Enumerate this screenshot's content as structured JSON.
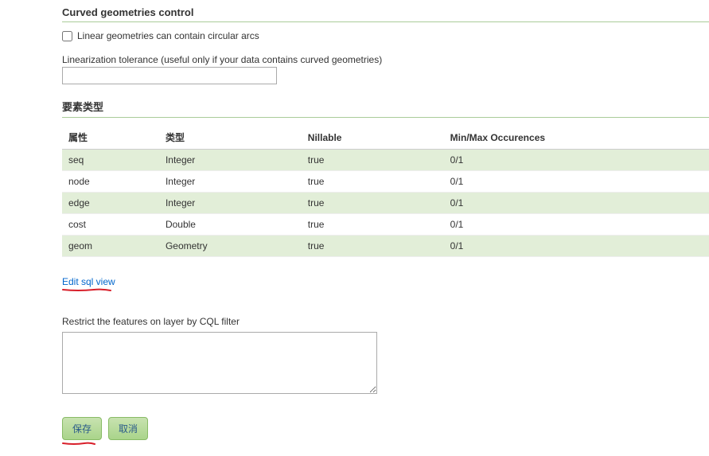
{
  "curvedGeometries": {
    "title": "Curved geometries control",
    "checkboxLabel": "Linear geometries can contain circular arcs",
    "linearizationLabel": "Linearization tolerance (useful only if your data contains curved geometries)",
    "linearizationValue": ""
  },
  "featureType": {
    "title": "要素类型",
    "headers": {
      "attribute": "属性",
      "type": "类型",
      "nillable": "Nillable",
      "minmax": "Min/Max Occurences"
    },
    "rows": [
      {
        "attr": "seq",
        "type": "Integer",
        "nillable": "true",
        "minmax": "0/1"
      },
      {
        "attr": "node",
        "type": "Integer",
        "nillable": "true",
        "minmax": "0/1"
      },
      {
        "attr": "edge",
        "type": "Integer",
        "nillable": "true",
        "minmax": "0/1"
      },
      {
        "attr": "cost",
        "type": "Double",
        "nillable": "true",
        "minmax": "0/1"
      },
      {
        "attr": "geom",
        "type": "Geometry",
        "nillable": "true",
        "minmax": "0/1"
      }
    ]
  },
  "editSqlLink": "Edit sql view",
  "cqlFilter": {
    "label": "Restrict the features on layer by CQL filter",
    "value": ""
  },
  "buttons": {
    "save": "保存",
    "cancel": "取消"
  }
}
